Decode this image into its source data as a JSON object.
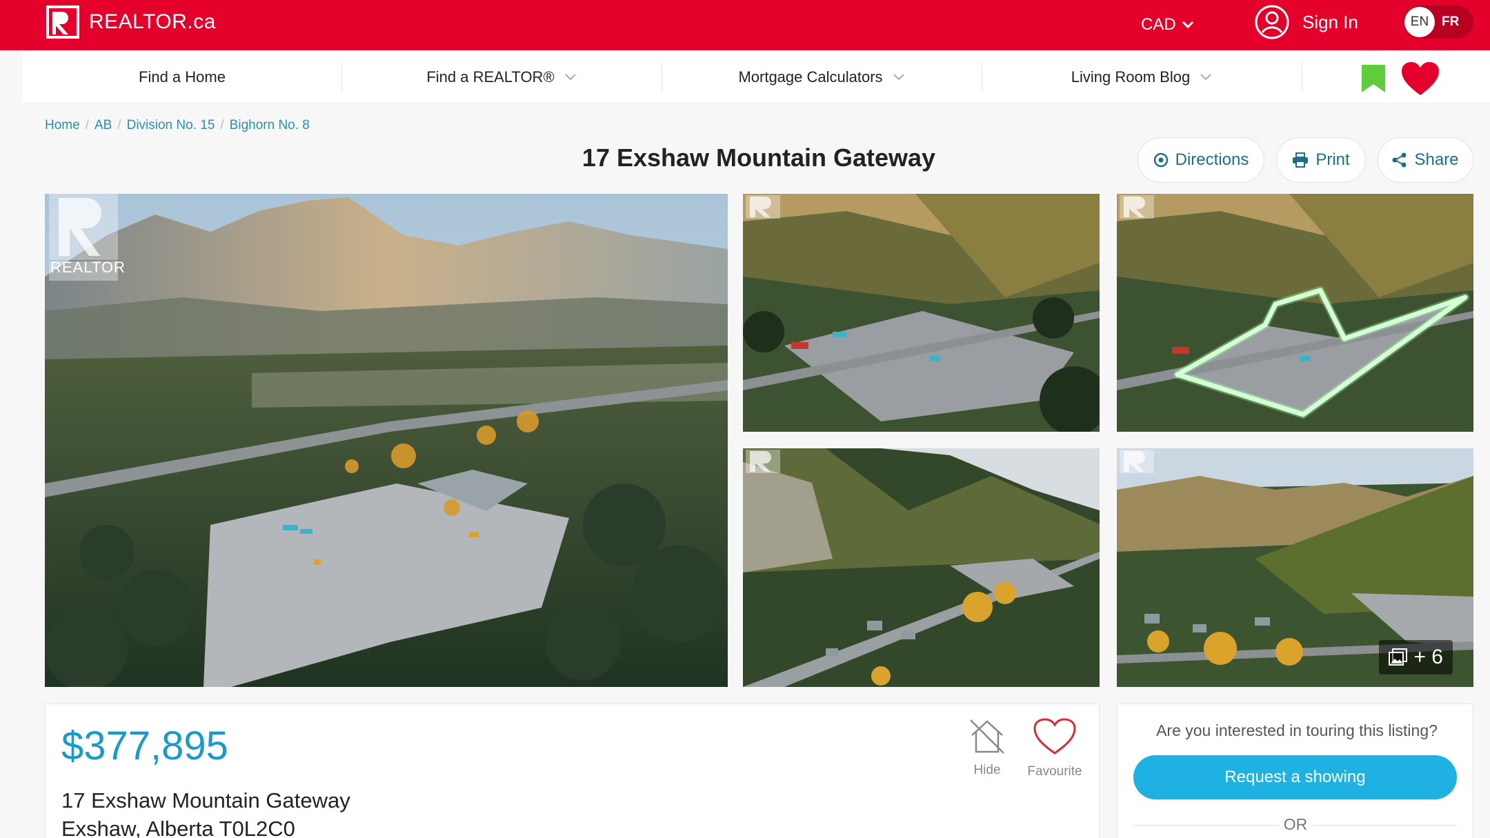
{
  "header": {
    "logo_text": "REALTOR.ca",
    "currency": "CAD",
    "sign_in": "Sign In",
    "lang_en": "EN",
    "lang_fr": "FR",
    "brand_color": "#e4002b"
  },
  "nav": {
    "items": [
      {
        "label": "Find a Home"
      },
      {
        "label": "Find a REALTOR®"
      },
      {
        "label": "Mortgage Calculators"
      },
      {
        "label": "Living Room Blog"
      }
    ]
  },
  "breadcrumb": [
    "Home",
    "AB",
    "Division No. 15",
    "Bighorn No. 8"
  ],
  "listing": {
    "title": "17 Exshaw Mountain Gateway",
    "actions": {
      "directions": "Directions",
      "print": "Print",
      "share": "Share"
    },
    "photos": {
      "watermark": "REALTOR",
      "more_count": "+ 6"
    },
    "price": "$377,895",
    "address_line1": "17 Exshaw Mountain Gateway",
    "address_line2": "Exshaw, Alberta T0L2C0",
    "hide_label": "Hide",
    "favourite_label": "Favourite"
  },
  "tour": {
    "question": "Are you interested in touring this listing?",
    "button": "Request a showing",
    "or": "OR",
    "accent_color": "#1fb1e1"
  }
}
